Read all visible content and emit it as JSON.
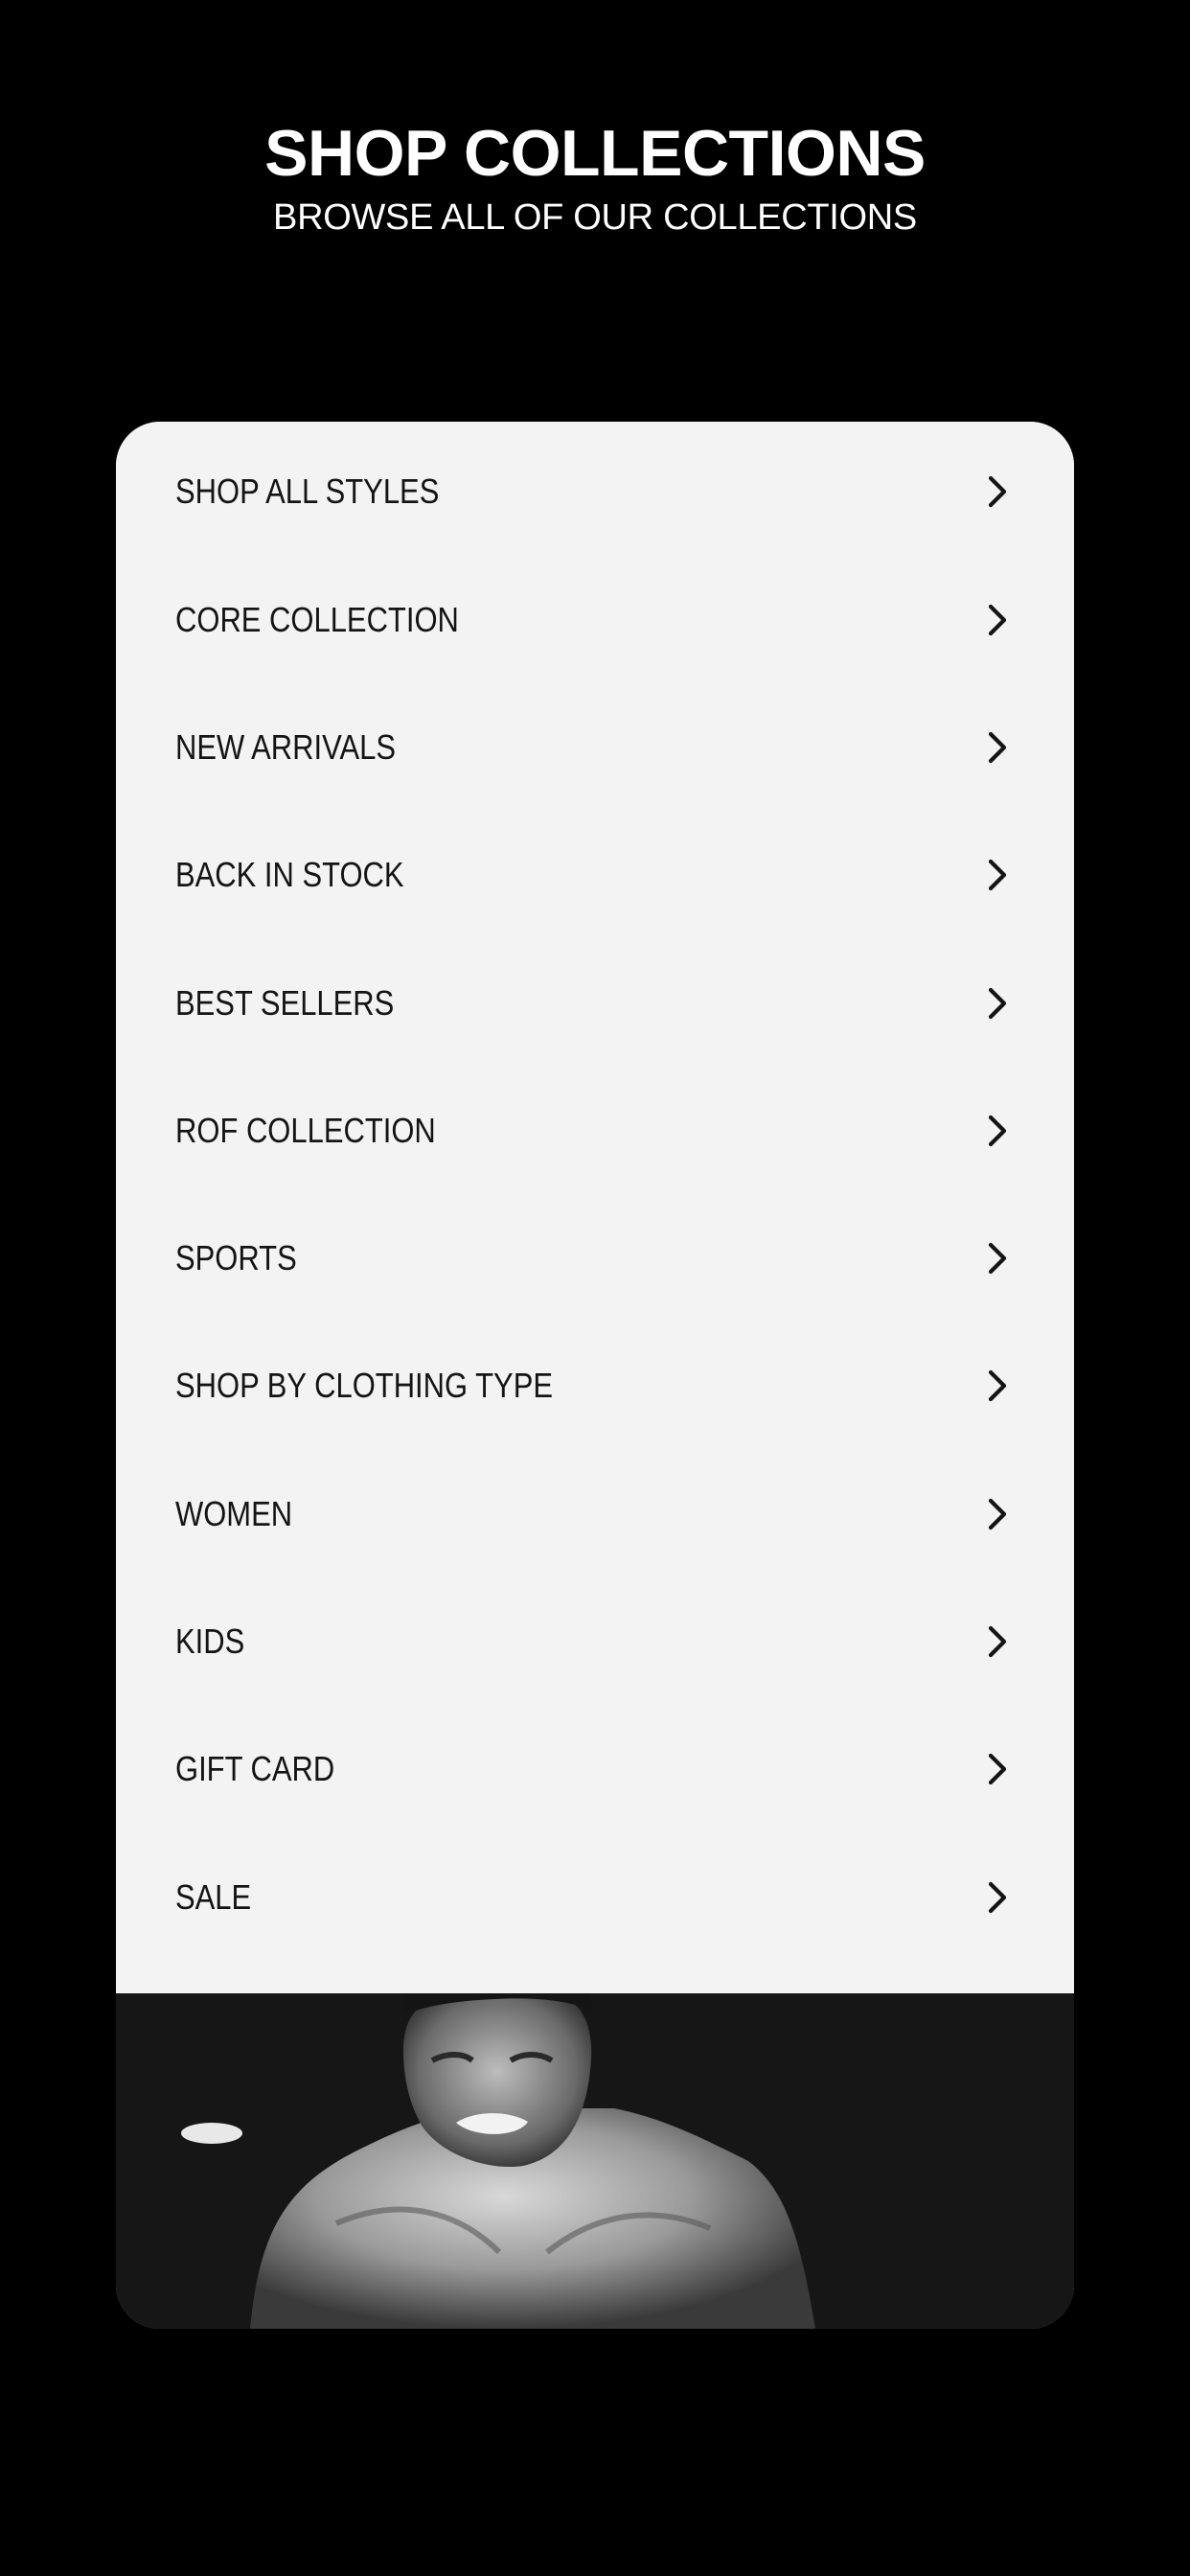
{
  "header": {
    "title": "SHOP COLLECTIONS",
    "subtitle": "BROWSE ALL OF OUR COLLECTIONS"
  },
  "menu": {
    "items": [
      {
        "label": "SHOP ALL STYLES",
        "icon": "chevron-right-icon"
      },
      {
        "label": "CORE COLLECTION",
        "icon": "chevron-right-icon"
      },
      {
        "label": "NEW ARRIVALS",
        "icon": "chevron-right-icon"
      },
      {
        "label": "BACK IN STOCK",
        "icon": "chevron-right-icon"
      },
      {
        "label": "BEST SELLERS",
        "icon": "chevron-right-icon"
      },
      {
        "label": "ROF COLLECTION",
        "icon": "chevron-right-icon"
      },
      {
        "label": "SPORTS",
        "icon": "chevron-right-icon"
      },
      {
        "label": "SHOP BY CLOTHING TYPE",
        "icon": "chevron-right-icon"
      },
      {
        "label": "WOMEN",
        "icon": "chevron-right-icon"
      },
      {
        "label": "KIDS",
        "icon": "chevron-right-icon"
      },
      {
        "label": "GIFT CARD",
        "icon": "chevron-right-icon"
      },
      {
        "label": "SALE",
        "icon": "chevron-right-icon"
      }
    ]
  },
  "colors": {
    "background": "#000000",
    "card": "#f3f3f3",
    "text": "#141414",
    "header_text": "#ffffff"
  }
}
